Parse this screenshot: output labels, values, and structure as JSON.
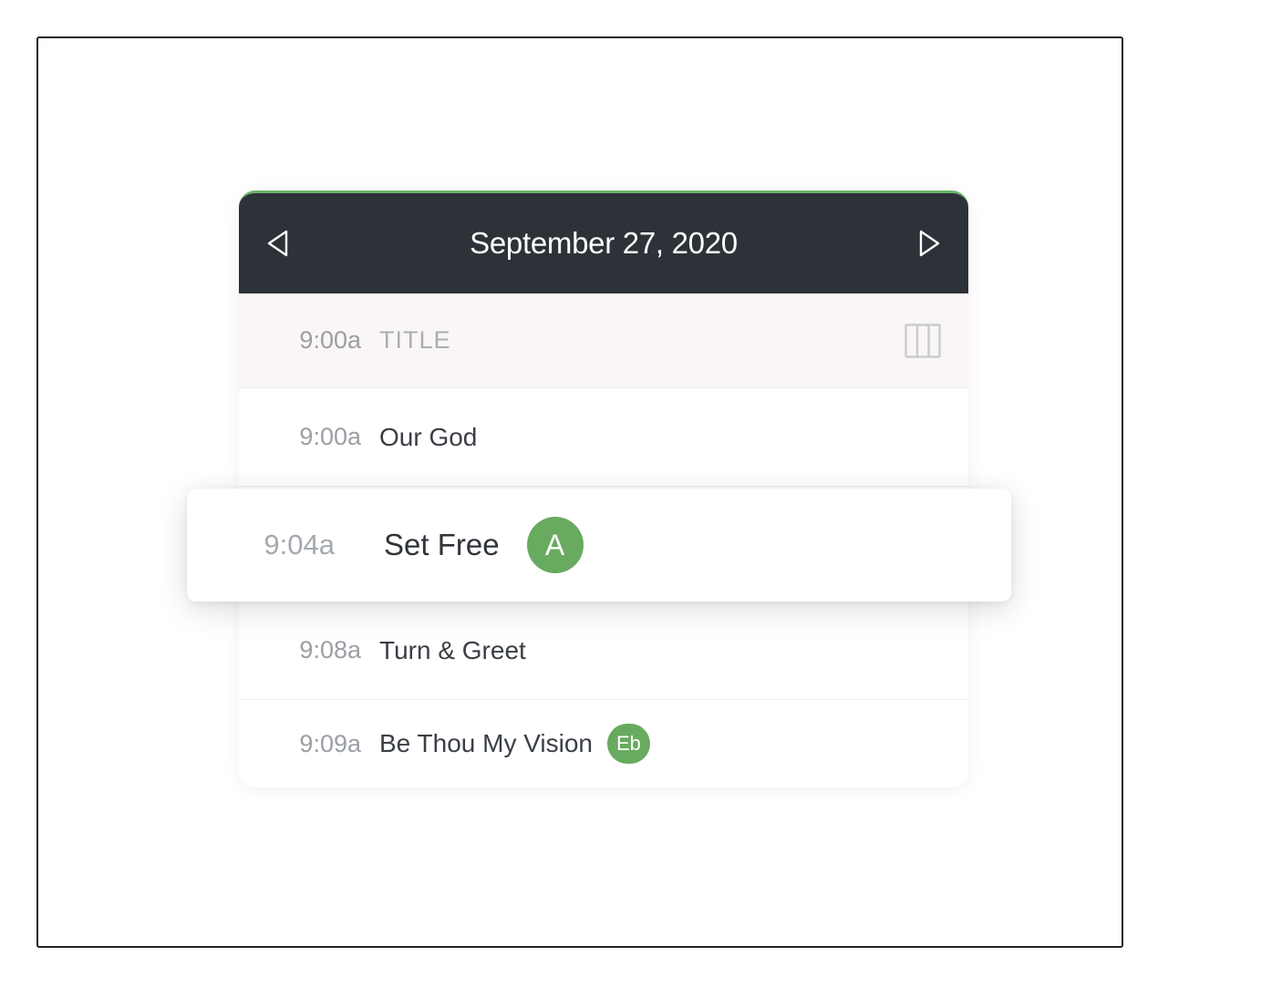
{
  "header": {
    "date": "September 27, 2020"
  },
  "subheader": {
    "time": "9:00a",
    "title_label": "TITLE"
  },
  "items": [
    {
      "time": "9:00a",
      "title": "Our God",
      "key": ""
    },
    {
      "time": "9:04a",
      "title": "Set Free",
      "key": "A",
      "selected": true
    },
    {
      "time": "9:08a",
      "title": "Turn & Greet",
      "key": ""
    },
    {
      "time": "9:09a",
      "title": "Be Thou My Vision",
      "key": "Eb"
    }
  ],
  "colors": {
    "key_badge": "#68aa5f",
    "header_bg": "#2d3238"
  }
}
